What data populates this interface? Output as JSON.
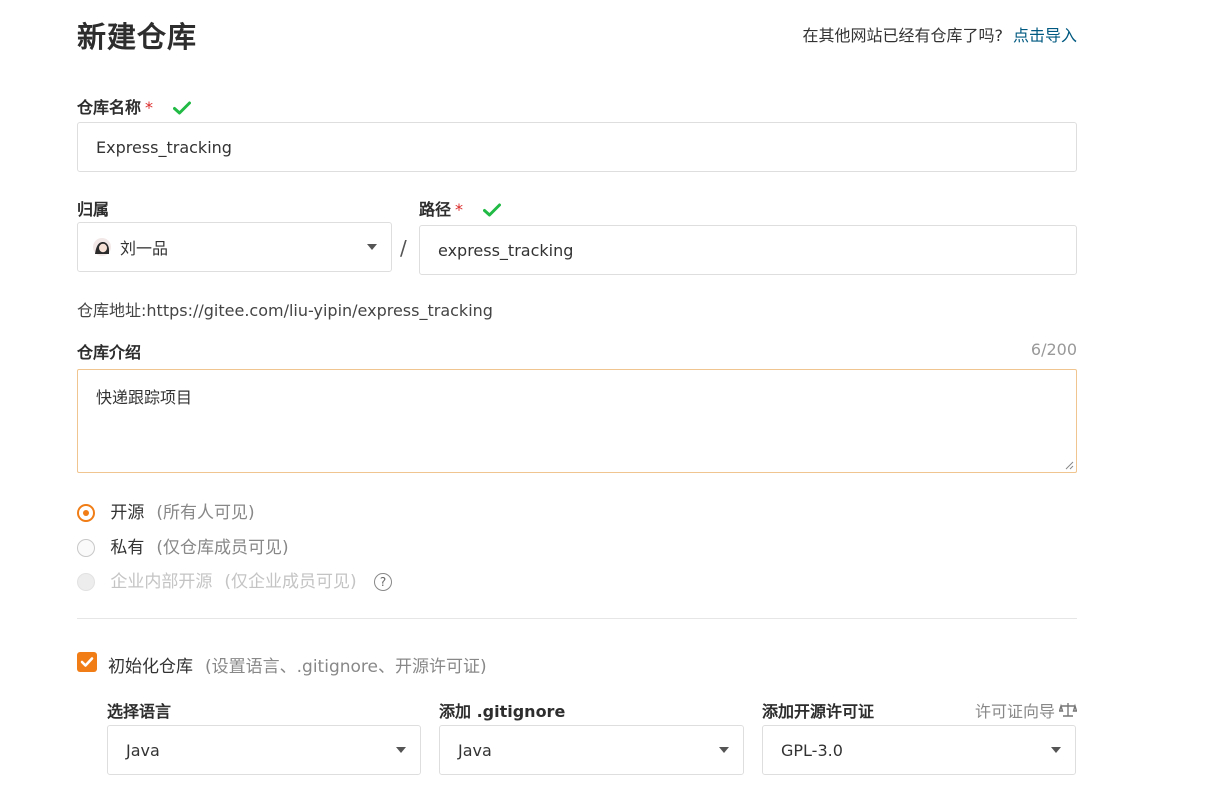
{
  "page": {
    "title": "新建仓库",
    "import_prompt": "在其他网站已经有仓库了吗?",
    "import_link": "点击导入"
  },
  "repo_name": {
    "label": "仓库名称",
    "required_mark": "*",
    "value": "Express_tracking"
  },
  "owner": {
    "label": "归属",
    "value": "刘一品",
    "separator": "/"
  },
  "path": {
    "label": "路径",
    "required_mark": "*",
    "value": "express_tracking"
  },
  "repo_address": {
    "label": "仓库地址:",
    "value": "https://gitee.com/liu-yipin/express_tracking"
  },
  "description": {
    "label": "仓库介绍",
    "counter": "6/200",
    "value": "快递跟踪项目"
  },
  "visibility": {
    "options": [
      {
        "label": "开源",
        "hint": "(所有人可见)",
        "selected": true,
        "disabled": false
      },
      {
        "label": "私有",
        "hint": "(仅仓库成员可见)",
        "selected": false,
        "disabled": false
      },
      {
        "label": "企业内部开源",
        "hint": "(仅企业成员可见)",
        "selected": false,
        "disabled": true
      }
    ],
    "help_icon": "help-circle-icon"
  },
  "init": {
    "label": "初始化仓库",
    "hint": "(设置语言、.gitignore、开源许可证)",
    "checked": true
  },
  "language": {
    "label": "选择语言",
    "value": "Java"
  },
  "gitignore": {
    "label": "添加 .gitignore",
    "value": "Java"
  },
  "license": {
    "label": "添加开源许可证",
    "guide": "许可证向导",
    "value": "GPL-3.0"
  },
  "colors": {
    "accent": "#f07d16",
    "success": "#21ba45",
    "required": "#db2828",
    "link": "#005980"
  }
}
